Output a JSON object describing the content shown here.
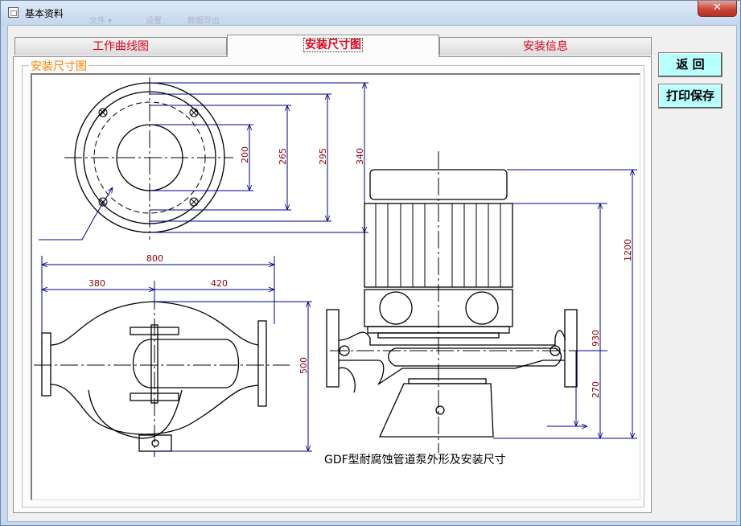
{
  "window": {
    "title": "基本资料",
    "close_label": "✕",
    "menu_ghost": [
      "文件 ▾",
      "设置",
      "数据导出"
    ]
  },
  "tabs": [
    {
      "label": "工作曲线图",
      "active": false
    },
    {
      "label": "安装尺寸图",
      "active": true
    },
    {
      "label": "安装信息",
      "active": false
    }
  ],
  "group": {
    "label": "安装尺寸图"
  },
  "buttons": {
    "back": "返  回",
    "print_save": "打印保存"
  },
  "drawing": {
    "caption": "GDF型耐腐蚀管道泵外形及安装尺寸",
    "flange_dims": [
      "200",
      "265",
      "295",
      "340"
    ],
    "top_view_dims": [
      "800",
      "380",
      "420",
      "500"
    ],
    "side_view_dims": [
      "1200",
      "930",
      "270"
    ]
  },
  "colors": {
    "tab_text": "#e0001b",
    "group_label": "#ff8000",
    "dim_line": "#00008b",
    "button_bg": "#b8ffff"
  }
}
